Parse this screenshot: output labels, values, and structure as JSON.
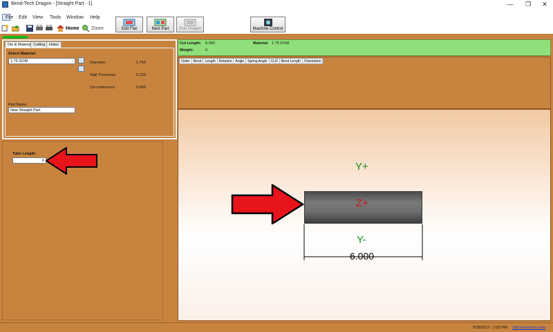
{
  "window": {
    "title": "Bend-Tech Dragon - [Straight Part - 1]",
    "min_symbol": "—",
    "max_symbol": "❐",
    "close_symbol": "✕"
  },
  "menu": {
    "items": [
      "File",
      "Edit",
      "View",
      "Tools",
      "Window",
      "Help"
    ]
  },
  "toolbar": {
    "home_label": "Home",
    "zoom_label": "Zoom",
    "buttons": {
      "edit_flat": "Edit Flat",
      "nest_part": "Nest Part",
      "run_project": "Run Project",
      "machine_control": "Machine Control"
    }
  },
  "left_panel": {
    "tabs": [
      "Die & Material",
      "Cutting",
      "Holes"
    ],
    "select_material_label": "Select Material:",
    "material_value": "1.75 DOM",
    "diameter_label": "Diameter:",
    "diameter_value": "1.750",
    "wall_label": "Wall Thickness:",
    "wall_value": "0.120",
    "circumference_label": "Circumference:",
    "circumference_value": "5.498",
    "part_name_label": "Part Name:",
    "part_name_value": "New Straight Part"
  },
  "tube_length": {
    "label": "Tube Length:",
    "value": "6"
  },
  "info_bar": {
    "cut_length_label": "Cut Length:",
    "cut_length_value": "6.000",
    "material_label": "Material:",
    "material_value": "1.75 DOM",
    "weight_label": "Weight:",
    "weight_value": "0"
  },
  "grid": {
    "columns": [
      "Order",
      "Bend",
      "Length",
      "Rotation",
      "Angle",
      "Spring Angle",
      "CLR",
      "Bend Length",
      "Orientation"
    ]
  },
  "viewport": {
    "y_plus": "Y+",
    "z_plus": "Z+",
    "y_minus": "Y-",
    "dimension": "6.000"
  },
  "status": {
    "datetime": "9/28/2017 - 2:53 PM",
    "link": "Visit bend-tech.com"
  },
  "colors": {
    "background": "#c8843f",
    "info_bar": "#8fe07a",
    "arrow_red": "#e8141c",
    "axis_green": "#118a11",
    "axis_red": "#d01010"
  },
  "icons": [
    "app-icon",
    "new-icon",
    "open-icon",
    "save-icon",
    "print-icon",
    "print-preview-icon",
    "home-icon",
    "zoom-icon",
    "edit-flat-icon",
    "nest-part-icon",
    "run-project-icon",
    "machine-control-icon",
    "material-picker-icon",
    "copy-icon",
    "arrow-icon"
  ]
}
